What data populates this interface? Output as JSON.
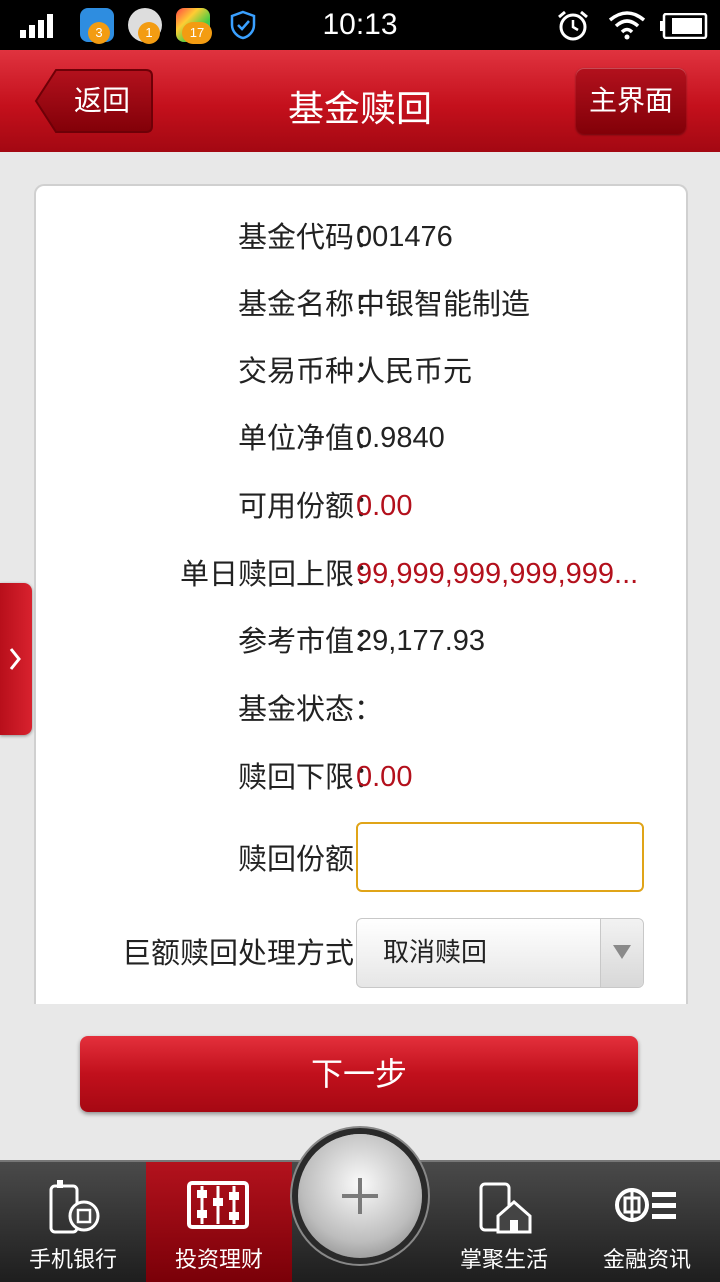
{
  "status_bar": {
    "time": "10:13",
    "badges": [
      "3",
      "1",
      "17"
    ]
  },
  "header": {
    "back_label": "返回",
    "title": "基金赎回",
    "home_label": "主界面"
  },
  "form": {
    "rows": [
      {
        "label": "基金代码",
        "value": "001476",
        "highlight": false
      },
      {
        "label": "基金名称",
        "value": "中银智能制造",
        "highlight": false
      },
      {
        "label": "交易币种",
        "value": "人民币元",
        "highlight": false
      },
      {
        "label": "单位净值",
        "value": "0.9840",
        "highlight": false
      },
      {
        "label": "可用份额",
        "value": "0.00",
        "highlight": true
      },
      {
        "label": "单日赎回上限",
        "value": "99,999,999,999,999...",
        "highlight": true
      },
      {
        "label": "参考市值",
        "value": "29,177.93",
        "highlight": false
      },
      {
        "label": "基金状态",
        "value": "",
        "highlight": false
      },
      {
        "label": "赎回下限",
        "value": "0.00",
        "highlight": true
      }
    ],
    "colon": "：",
    "redeem_shares_label": "赎回份额",
    "redeem_shares_value": "",
    "large_redeem_label": "巨额赎回处理方式",
    "large_redeem_selected": "取消赎回"
  },
  "next_button": "下一步",
  "bottom_nav": {
    "items": [
      "手机银行",
      "投资理财",
      "掌聚生活",
      "金融资讯"
    ],
    "active_index": 1
  },
  "colors": {
    "brand_red": "#c4101c",
    "value_red": "#b3101c",
    "input_border": "#e0a418"
  }
}
